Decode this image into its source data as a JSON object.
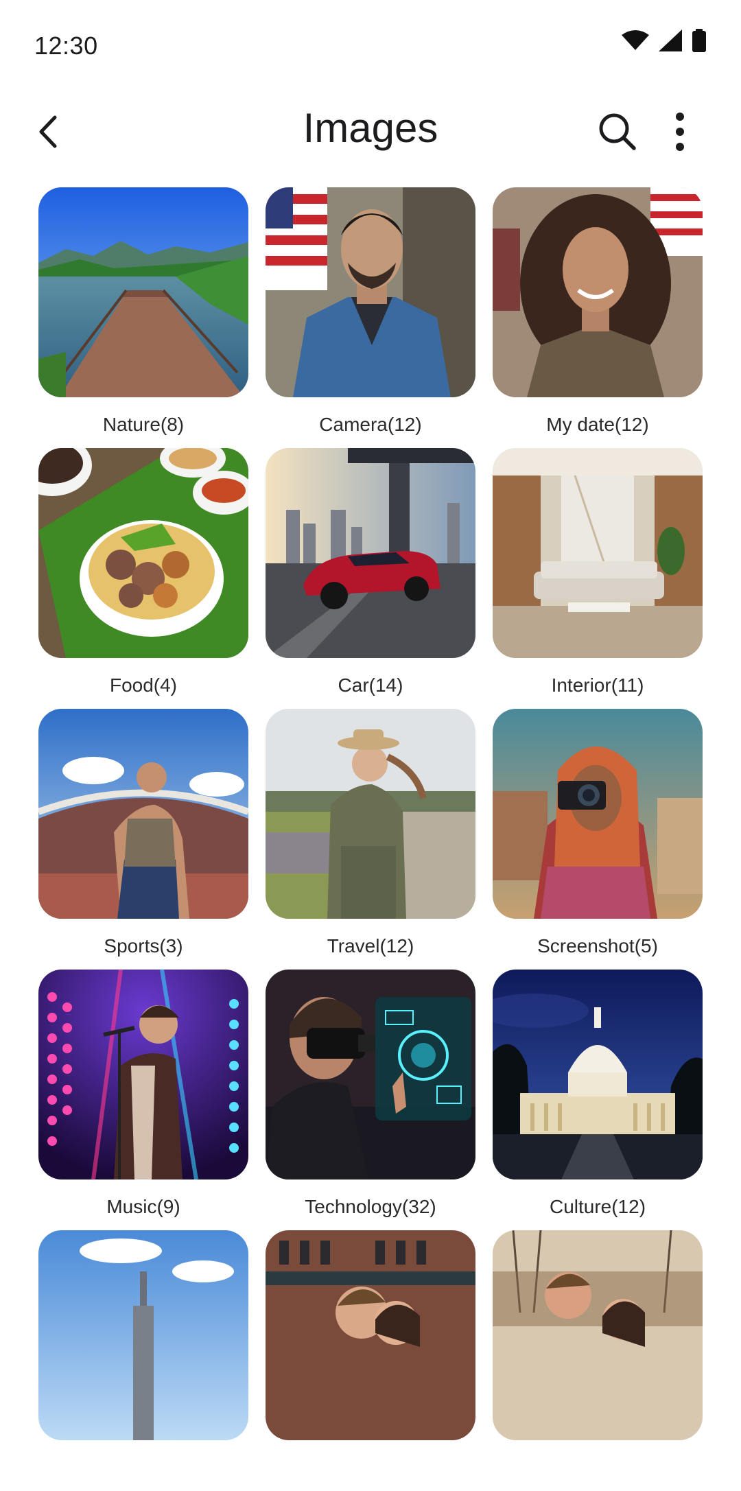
{
  "status_bar": {
    "time": "12:30",
    "icons": [
      "wifi-icon",
      "signal-icon",
      "battery-icon"
    ]
  },
  "app_bar": {
    "title": "Images",
    "back_icon": "chevron-left-icon",
    "search_icon": "search-icon",
    "more_icon": "more-vertical-icon"
  },
  "albums": [
    {
      "label": "Nature(8)",
      "scene": "lake-pier"
    },
    {
      "label": "Camera(12)",
      "scene": "man-denim"
    },
    {
      "label": "My date(12)",
      "scene": "woman-curly"
    },
    {
      "label": "Food(4)",
      "scene": "noodle-bowl"
    },
    {
      "label": "Car(14)",
      "scene": "red-car"
    },
    {
      "label": "Interior(11)",
      "scene": "living-room"
    },
    {
      "label": "Sports(3)",
      "scene": "stadium-athlete"
    },
    {
      "label": "Travel(12)",
      "scene": "woman-hat"
    },
    {
      "label": "Screenshot(5)",
      "scene": "girl-camera"
    },
    {
      "label": "Music(9)",
      "scene": "singer-stage"
    },
    {
      "label": "Technology(32)",
      "scene": "vr-headset"
    },
    {
      "label": "Culture(12)",
      "scene": "capitol-night"
    },
    {
      "label": "",
      "scene": "city-sky"
    },
    {
      "label": "",
      "scene": "couple-street"
    },
    {
      "label": "",
      "scene": "couple-autumn"
    }
  ],
  "colors": {
    "background": "#ffffff",
    "text": "#1c1c1e",
    "label": "#2a2a2a"
  }
}
